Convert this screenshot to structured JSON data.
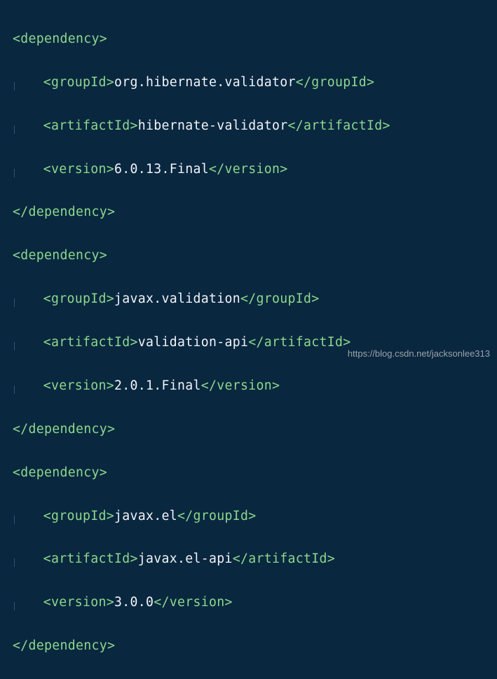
{
  "watermark": "https://blog.csdn.net/jacksonlee313",
  "dependencies": [
    {
      "groupId": "org.hibernate.validator",
      "artifactId": "hibernate-validator",
      "version": "6.0.13.Final"
    },
    {
      "groupId": "javax.validation",
      "artifactId": "validation-api",
      "version": "2.0.1.Final"
    },
    {
      "groupId": "javax.el",
      "artifactId": "javax.el-api",
      "version": "3.0.0"
    }
  ]
}
